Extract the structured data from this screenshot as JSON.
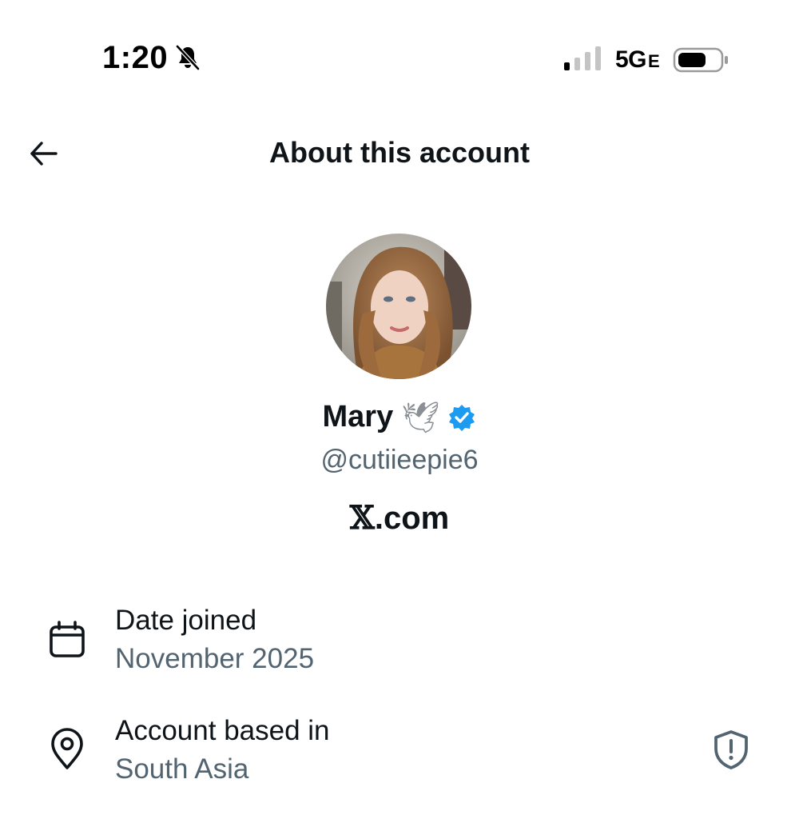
{
  "status_bar": {
    "time": "1:20",
    "network": "5G",
    "network_suffix": "E",
    "icons": [
      "bell-off-icon",
      "signal-icon",
      "battery-icon"
    ]
  },
  "header": {
    "back_icon": "arrow-left-icon",
    "title": "About this account"
  },
  "profile": {
    "display_name": "Mary",
    "name_emoji": "🕊",
    "verified": true,
    "handle": "@cutiieepie6",
    "platform_x": "𝕏",
    "platform_suffix": ".com"
  },
  "details": {
    "date_joined": {
      "icon": "calendar-icon",
      "label": "Date joined",
      "value": "November 2025"
    },
    "account_based": {
      "icon": "location-pin-icon",
      "label": "Account based in",
      "value": "South Asia",
      "trailing_icon": "shield-alert-icon"
    }
  },
  "colors": {
    "primary_text": "#0f1419",
    "secondary_text": "#536471",
    "verified_blue": "#1d9bf0"
  }
}
